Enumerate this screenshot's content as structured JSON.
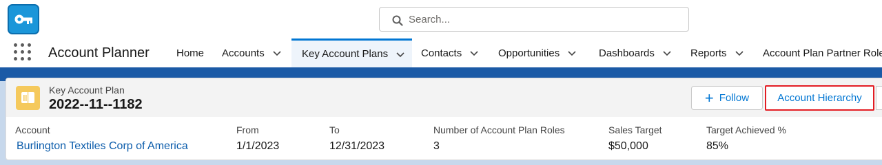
{
  "search": {
    "placeholder": "Search..."
  },
  "nav": {
    "app_name": "Account Planner",
    "items": [
      {
        "label": "Home",
        "has_menu": false,
        "active": false
      },
      {
        "label": "Accounts",
        "has_menu": true,
        "active": false
      },
      {
        "label": "Key Account Plans",
        "has_menu": true,
        "active": true
      },
      {
        "label": "Contacts",
        "has_menu": true,
        "active": false
      },
      {
        "label": "Opportunities",
        "has_menu": true,
        "active": false
      },
      {
        "label": "Dashboards",
        "has_menu": true,
        "active": false
      },
      {
        "label": "Reports",
        "has_menu": true,
        "active": false
      },
      {
        "label": "Account Plan Partner Roles",
        "has_menu": false,
        "active": false
      }
    ]
  },
  "record": {
    "object_label": "Key Account Plan",
    "name": "2022--11--1182",
    "actions": {
      "follow": "Follow",
      "hierarchy": "Account Hierarchy"
    },
    "fields": [
      {
        "label": "Account",
        "value": "Burlington Textiles Corp of America",
        "is_link": true
      },
      {
        "label": "From",
        "value": "1/1/2023",
        "is_link": false
      },
      {
        "label": "To",
        "value": "12/31/2023",
        "is_link": false
      },
      {
        "label": "Number of Account Plan Roles",
        "value": "3",
        "is_link": false
      },
      {
        "label": "Sales Target",
        "value": "$50,000",
        "is_link": false
      },
      {
        "label": "Target Achieved %",
        "value": "85%",
        "is_link": false
      }
    ]
  },
  "colors": {
    "brand": "#0176d3",
    "app_logo": "#1b96d9",
    "record_icon": "#f5c95c",
    "highlight_border": "#e31c23"
  }
}
